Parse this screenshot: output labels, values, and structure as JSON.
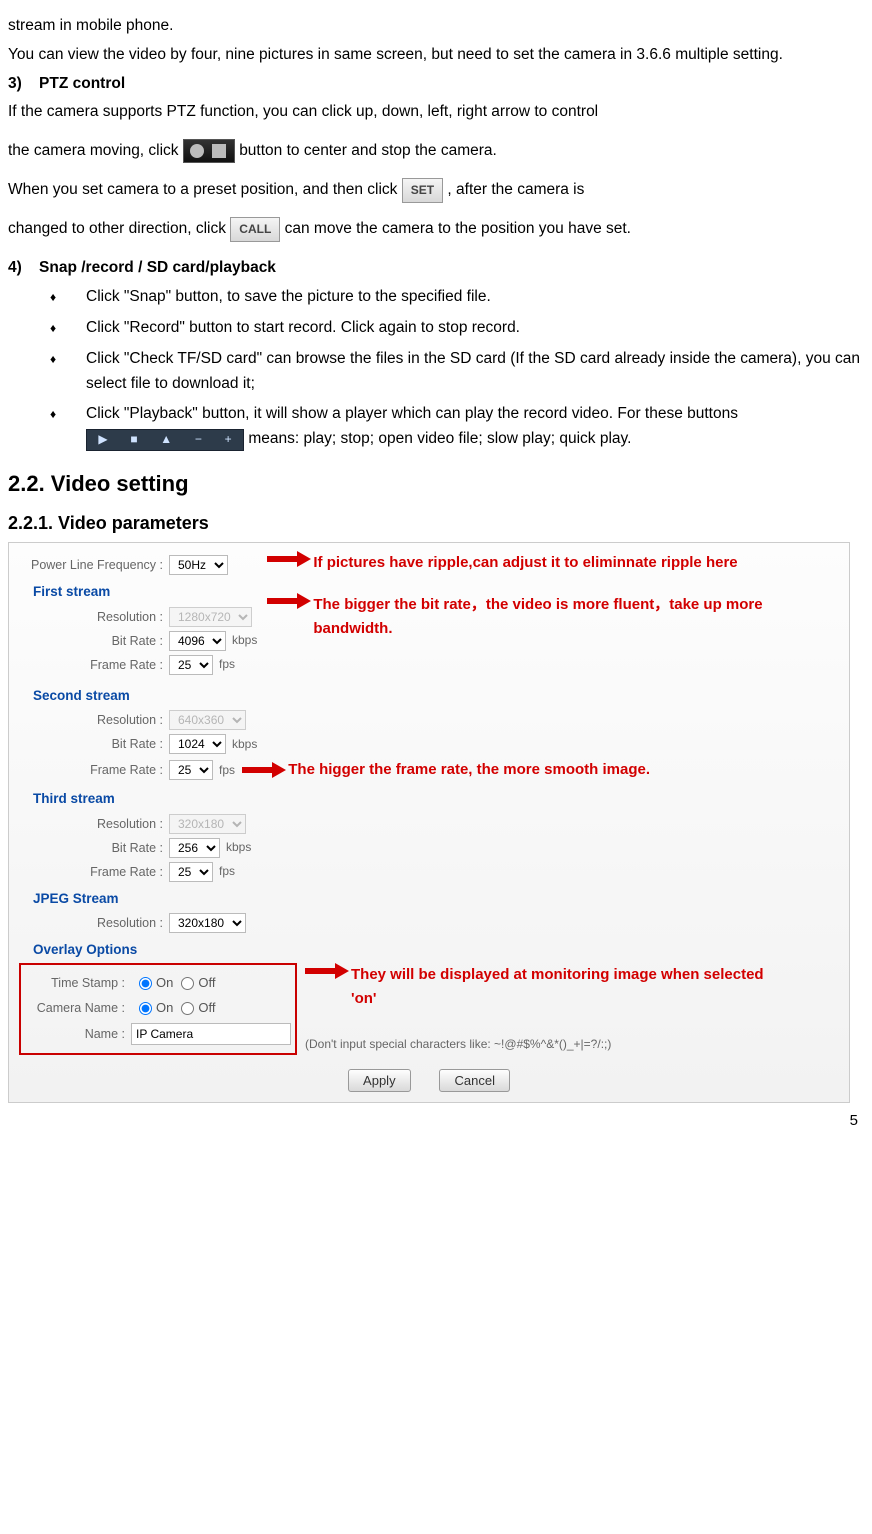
{
  "intro": {
    "p1": "stream in mobile phone.",
    "p2": "You can view the video by four, nine pictures in same screen, but need to set the camera in 3.6.6 multiple setting."
  },
  "s3": {
    "num": "3)",
    "title": "PTZ control",
    "p1": "If the camera supports PTZ function, you can click up, down, left, right arrow to control",
    "p2a": "the camera moving, click ",
    "p2b": " button to center and stop the camera.",
    "p3a": "When you set camera to a preset position, and then click ",
    "set_label": "SET",
    "p3b": ", after the camera is",
    "p4a": "changed to other direction, click ",
    "call_label": "CALL",
    "p4b": " can move the camera to the position you have set."
  },
  "s4": {
    "num": "4)",
    "title": "Snap /record / SD card/playback",
    "b1": "Click \"Snap\" button, to save the picture to the specified file.",
    "b2": "Click \"Record\" button to start record. Click again to stop record.",
    "b3": "Click \"Check TF/SD card\" can browse the files in the SD card (If the SD card already inside the camera), you can select file to download it;",
    "b4a": "Click \"Playback\" button, it will show a player which can play the record video. For these buttons ",
    "b4b": " means: play; stop; open video file; slow play; quick play."
  },
  "h2": "2.2. Video setting",
  "h3": "2.2.1.  Video parameters",
  "panel": {
    "plf_label": "Power Line Frequency :",
    "plf_value": "50Hz",
    "grp1": "First stream",
    "grp2": "Second stream",
    "grp3": "Third stream",
    "grp4": "JPEG Stream",
    "grp5": "Overlay Options",
    "res_label": "Resolution :",
    "bit_label": "Bit Rate :",
    "frame_label": "Frame Rate :",
    "g1_res": "1280x720",
    "g1_bit": "4096",
    "g1_fps": "25",
    "g2_res": "640x360",
    "g2_bit": "1024",
    "g2_fps": "25",
    "g3_res": "320x180",
    "g3_bit": "256",
    "g3_fps": "25",
    "g4_res": "320x180",
    "kbps": "kbps",
    "fps": "fps",
    "ts_label": "Time Stamp :",
    "cn_label": "Camera Name :",
    "name_label": "Name :",
    "on": "On",
    "off": "Off",
    "name_value": "IP Camera",
    "hint": "(Don't input special characters like: ~!@#$%^&*()_+|=?/:;)",
    "apply": "Apply",
    "cancel": "Cancel"
  },
  "annos": {
    "a1": "If pictures have ripple,can adjust it to eliminnate ripple here",
    "a2": "The bigger the bit rate，the video is more fluent，take up more bandwidth.",
    "a3": "The higger the frame rate, the more smooth image.",
    "a4": "They will be displayed at monitoring image when selected 'on'"
  },
  "page_number": "5"
}
